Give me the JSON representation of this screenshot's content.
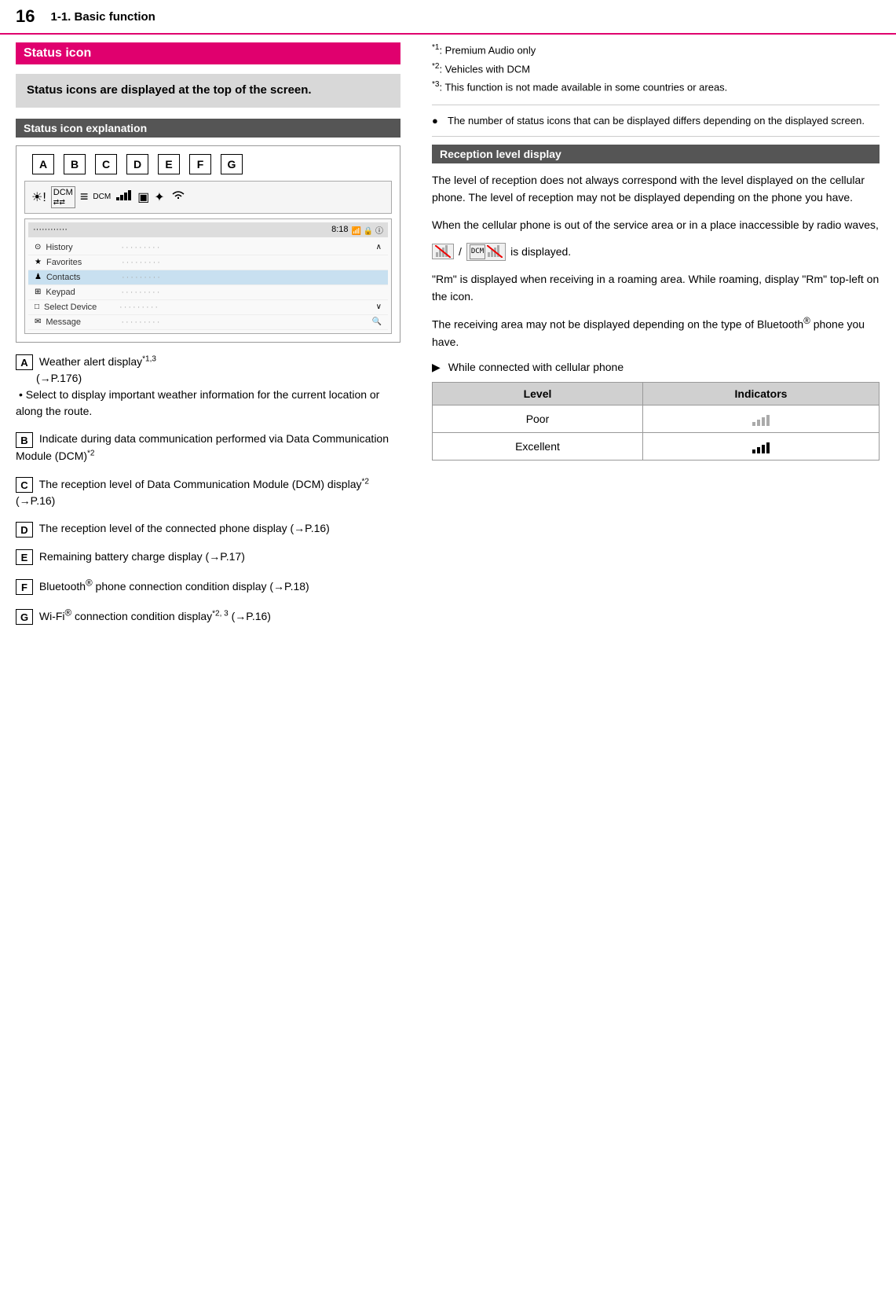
{
  "header": {
    "page_number": "16",
    "section_title": "1-1. Basic function"
  },
  "left_column": {
    "heading_pink": "Status icon",
    "info_box_text": "Status icons are displayed at the top of the screen.",
    "heading_gray": "Status icon explanation",
    "icon_labels": [
      "A",
      "B",
      "C",
      "D",
      "E",
      "F",
      "G"
    ],
    "items": [
      {
        "letter": "A",
        "text": "Weather alert display",
        "sup": "*1,3",
        "link": "(→P.176)",
        "bullet": "Select to display important weather information for the current location or along the route."
      },
      {
        "letter": "B",
        "text": "Indicate during data communication performed via Data Communication Module (DCM)",
        "sup": "*2"
      },
      {
        "letter": "C",
        "text": "The reception level of Data Communication Module (DCM) display",
        "sup": "*2",
        "link": "(→P.16)"
      },
      {
        "letter": "D",
        "text": "The reception level of the connected phone display",
        "link": "(→P.16)"
      },
      {
        "letter": "E",
        "text": "Remaining battery charge display",
        "link": "(→P.17)"
      },
      {
        "letter": "F",
        "text": "Bluetooth® phone connection condition display",
        "link": "(→P.18)"
      },
      {
        "letter": "G",
        "text": "Wi-Fi® connection condition display",
        "sup": "*2, 3",
        "link": "(→P.16)"
      }
    ],
    "footnotes": [
      {
        "key": "*1",
        "text": "Premium Audio only"
      },
      {
        "key": "*2",
        "text": "Vehicles with DCM"
      },
      {
        "key": "*3",
        "text": "This function is not made available in some countries or areas."
      }
    ]
  },
  "right_column": {
    "note_text": "The number of status icons that can be displayed differs depending on the displayed screen.",
    "reception_heading": "Reception level display",
    "para1": "The level of reception does not always correspond with the level displayed on the cellular phone. The level of reception may not be displayed depending on the phone you have.",
    "para2": "When the cellular phone is out of the service area or in a place inaccessible by radio waves,",
    "is_displayed": "is displayed.",
    "para3": "\"Rm\" is displayed when receiving in a roaming area. While roaming, display \"Rm\" top-left on the icon.",
    "para4": "The receiving area may not be displayed depending on the type of Bluetooth® phone you have.",
    "connected_label": "While connected with cellular phone",
    "table": {
      "headers": [
        "Level",
        "Indicators"
      ],
      "rows": [
        {
          "level": "Poor",
          "indicator_type": "poor"
        },
        {
          "level": "Excellent",
          "indicator_type": "excellent"
        }
      ]
    }
  },
  "screen_mockup": {
    "time": "8:18",
    "list_items": [
      {
        "icon": "⊙",
        "label": "History",
        "dots": "·········"
      },
      {
        "icon": "★",
        "label": "Favorites",
        "dots": "·········"
      },
      {
        "icon": "♟",
        "label": "Contacts",
        "dots": "·········"
      },
      {
        "icon": "⊞",
        "label": "Keypad",
        "dots": "·········"
      },
      {
        "icon": "□",
        "label": "Select Device",
        "dots": "·········"
      },
      {
        "icon": "✉",
        "label": "Message",
        "dots": "·········"
      }
    ]
  }
}
